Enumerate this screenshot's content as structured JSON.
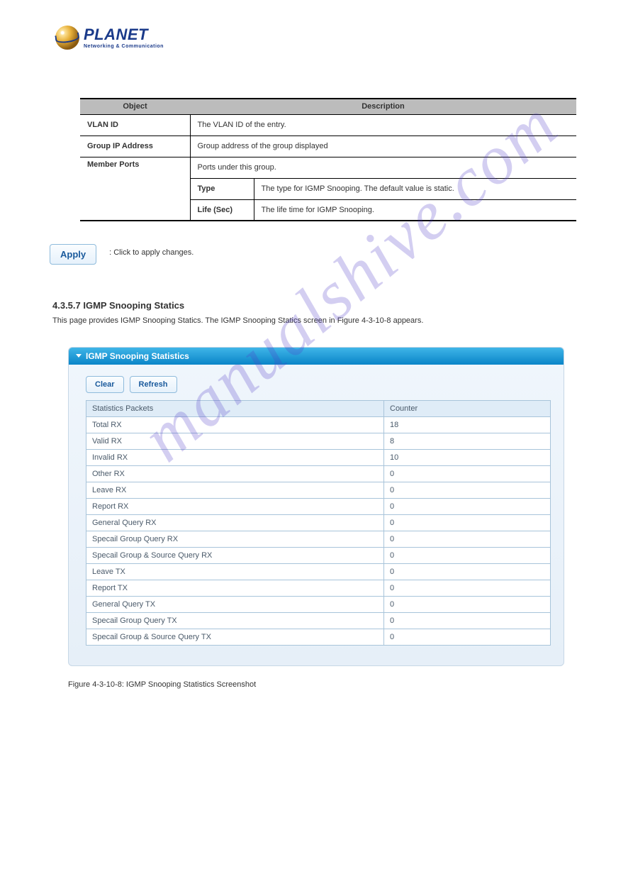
{
  "logo": {
    "title": "PLANET",
    "subtitle": "Networking & Communication"
  },
  "obj_table": {
    "head_object": "Object",
    "head_description": "Description",
    "rows": [
      {
        "object": "VLAN ID",
        "desc": "The VLAN ID of the entry."
      },
      {
        "object": "Group IP Address",
        "desc": "Group address of the group displayed"
      }
    ],
    "group_object": "Member Ports",
    "group_desc": "Ports under this group.",
    "sub_rows": [
      {
        "sub": "Type",
        "desc": "The type for IGMP Snooping. The default value is static."
      },
      {
        "sub": "Life (Sec)",
        "desc": "The life time for IGMP Snooping."
      }
    ]
  },
  "buttons": {
    "apply_label": "Apply",
    "apply_desc": ": Click to apply changes.",
    "clear_label": "Clear",
    "refresh_label": "Refresh"
  },
  "section": {
    "number": "4.3.5.7 IGMP Snooping Statics",
    "desc": "This page provides IGMP Snooping Statics. The IGMP Snooping Statics screen in Figure 4-3-10-8 appears."
  },
  "panel": {
    "title": "IGMP Snooping Statistics",
    "head_packets": "Statistics Packets",
    "head_counter": "Counter",
    "stats": [
      {
        "label": "Total RX",
        "value": "18"
      },
      {
        "label": "Valid RX",
        "value": "8"
      },
      {
        "label": "Invalid RX",
        "value": "10"
      },
      {
        "label": "Other RX",
        "value": "0"
      },
      {
        "label": "Leave RX",
        "value": "0"
      },
      {
        "label": "Report RX",
        "value": "0"
      },
      {
        "label": "General Query RX",
        "value": "0"
      },
      {
        "label": "Specail Group Query RX",
        "value": "0"
      },
      {
        "label": "Specail Group & Source Query RX",
        "value": "0"
      },
      {
        "label": "Leave TX",
        "value": "0"
      },
      {
        "label": "Report TX",
        "value": "0"
      },
      {
        "label": "General Query TX",
        "value": "0"
      },
      {
        "label": "Specail Group Query TX",
        "value": "0"
      },
      {
        "label": "Specail Group & Source Query TX",
        "value": "0"
      }
    ]
  },
  "figure_caption": "Figure 4-3-10-8: IGMP Snooping Statistics Screenshot",
  "watermark": "manualshive.com"
}
